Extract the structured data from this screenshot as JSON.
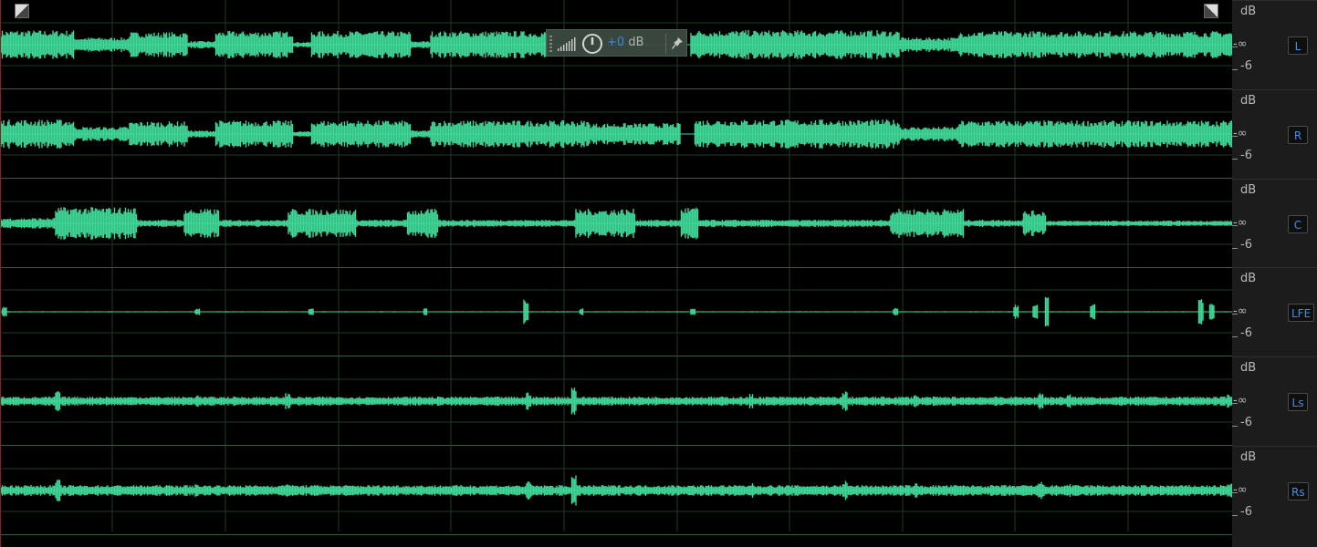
{
  "colors": {
    "waveform": "#3fd898",
    "grid": "#1e3a24",
    "centerline": "#3fd898",
    "background": "#000000",
    "channel_label": "#3f8fe8"
  },
  "hud": {
    "gain_value": "+0",
    "gain_unit": "dB"
  },
  "ruler": {
    "unit": "dB",
    "neg_inf": "-∞",
    "minus6": "-6"
  },
  "channels": [
    {
      "label": "L",
      "icon": "channel-L"
    },
    {
      "label": "R",
      "icon": "channel-R"
    },
    {
      "label": "C",
      "icon": "channel-C"
    },
    {
      "label": "LFE",
      "icon": "channel-LFE"
    },
    {
      "label": "Ls",
      "icon": "channel-Ls"
    },
    {
      "label": "Rs",
      "icon": "channel-Rs"
    }
  ],
  "icons": {
    "zoom_corner_left": "zoom-corner-icon",
    "zoom_corner_right": "zoom-corner-icon",
    "hud_grip": "grip-icon",
    "hud_meter": "level-bars-icon",
    "hud_power": "power-icon",
    "hud_pin": "pin-icon"
  }
}
